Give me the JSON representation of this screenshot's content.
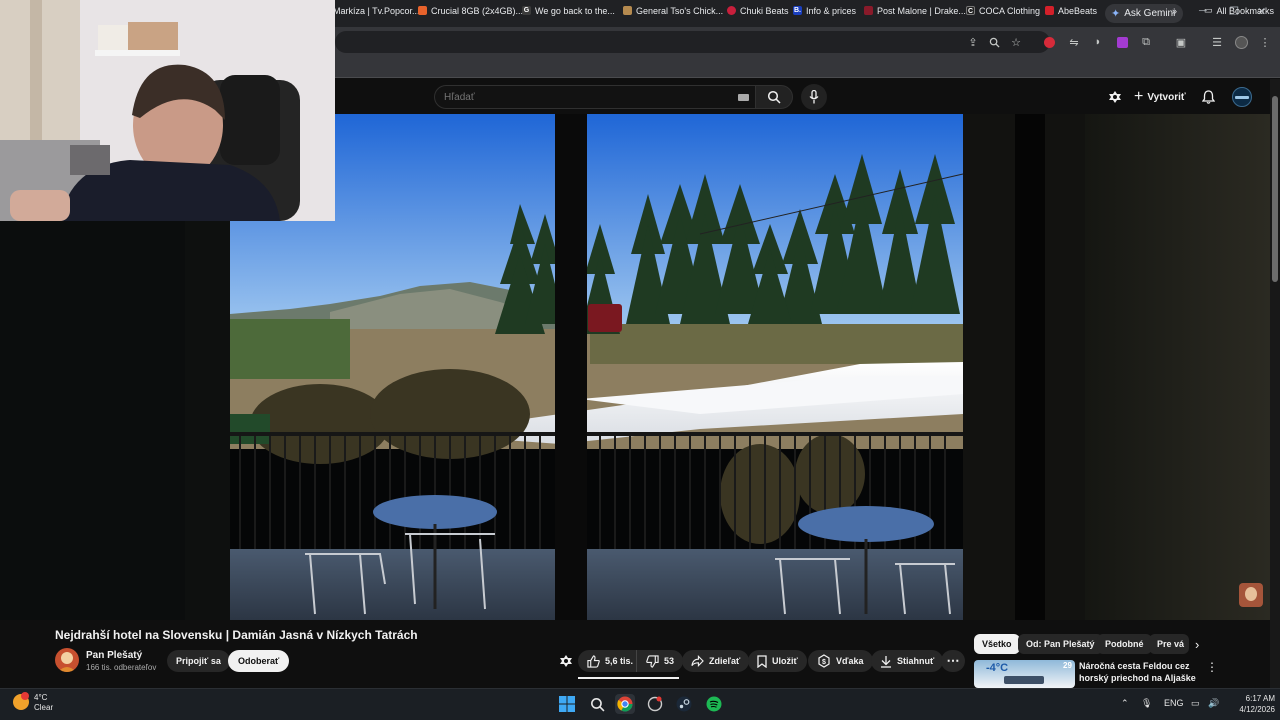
{
  "browser": {
    "gemini_label": "Ask Gemini",
    "bookmarks": [
      {
        "label": "Markíza | Tv.Popcor...",
        "color": "#2b2b2b"
      },
      {
        "label": "Crucial 8GB (2x4GB)...",
        "color": "#e8622b"
      },
      {
        "label": "We go back to the...",
        "color": "#3c3c3c",
        "glyph": "G"
      },
      {
        "label": "General Tso's Chick...",
        "color": "#b58a4f"
      },
      {
        "label": "Chuki Beats",
        "color": "#c81f3c"
      },
      {
        "label": "Info & prices",
        "color": "#1a3fbf",
        "glyph": "B."
      },
      {
        "label": "Post Malone | Drake...",
        "color": "#8a1a2a"
      },
      {
        "label": "COCA Clothing",
        "color": "#222222",
        "glyph": "C"
      },
      {
        "label": "AbeBeats",
        "color": "#d4202a"
      }
    ],
    "all_bookmarks": "All Bookmarks"
  },
  "youtube": {
    "search_placeholder": "Hľadať",
    "create_label": "Vytvoriť"
  },
  "video": {
    "title": "Nejdrahší hotel na Slovensku | Damián Jasná v Nízkych Tatrách",
    "channel": "Pan Plešatý",
    "subscribers": "166 tis. odberateľov",
    "join_label": "Pripojiť sa",
    "subscribe_label": "Odoberať",
    "likes": "5,6 tis.",
    "dislikes": "53",
    "share_label": "Zdieľať",
    "save_label": "Uložiť",
    "thanks_label": "Vďaka",
    "download_label": "Stiahnuť"
  },
  "chips": [
    "Všetko",
    "Od: Pan Plešatý",
    "Podobné",
    "Pre vá"
  ],
  "recommendation": {
    "title": "Náročná cesta Feldou cez horský priechod na Aljaške na ...",
    "number": "29",
    "thumb_text": "-4°C"
  },
  "taskbar": {
    "temperature": "4°C",
    "weather": "Clear",
    "language": "ENG",
    "time": "6:17 AM",
    "date": "4/12/2026"
  }
}
